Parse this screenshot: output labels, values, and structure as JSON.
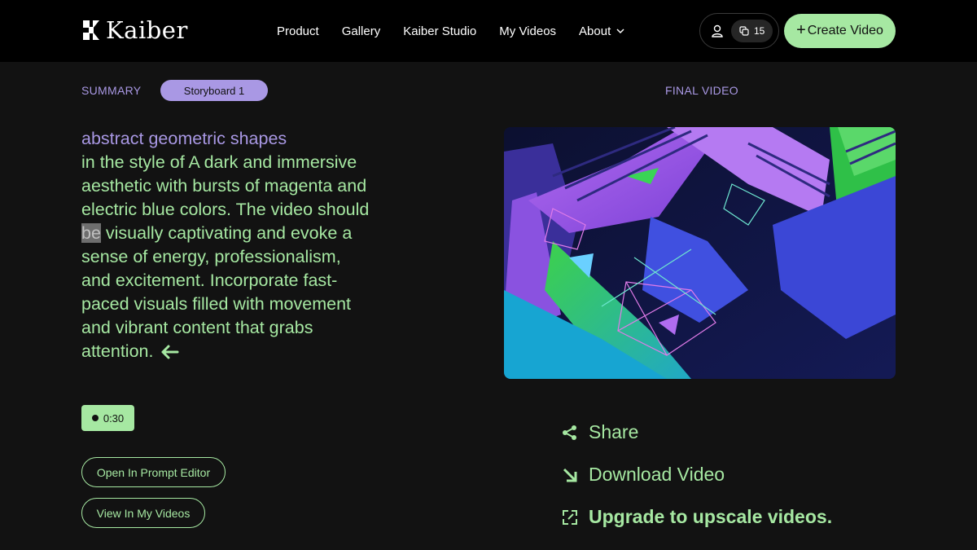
{
  "header": {
    "logo_text": "Kaiber",
    "nav": [
      {
        "label": "Product"
      },
      {
        "label": "Gallery"
      },
      {
        "label": "Kaiber Studio"
      },
      {
        "label": "My Videos"
      },
      {
        "label": "About"
      }
    ],
    "credits": "15",
    "create_label": "Create Video"
  },
  "summary": {
    "label": "SUMMARY",
    "storyboard_tab": "Storyboard 1",
    "prompt_subject": "abstract geometric shapes",
    "prompt_before": "in the style of A dark and immersive aesthetic with bursts of magenta and electric blue colors. The video should ",
    "prompt_highlight": "be",
    "prompt_after": " visually captivating and evoke a sense of energy, professionalism, and excitement. Incorporate fast-paced visuals filled with movement and vibrant content that grabs attention.",
    "duration": "0:30",
    "open_prompt_editor": "Open In Prompt Editor",
    "view_in_my_videos": "View In My Videos"
  },
  "final": {
    "label": "FINAL VIDEO",
    "share_label": "Share",
    "download_label": "Download Video",
    "upgrade_label": "Upgrade to upscale videos."
  },
  "colors": {
    "accent_green": "#a6e8a2",
    "accent_purple": "#a998e4",
    "background": "#121212",
    "header": "#000000"
  },
  "icons": [
    "kaiber-logo-icon",
    "chevron-down-icon",
    "user-icon",
    "credits-icon",
    "plus-icon",
    "arrow-left-icon",
    "share-icon",
    "download-icon",
    "upscale-icon"
  ]
}
